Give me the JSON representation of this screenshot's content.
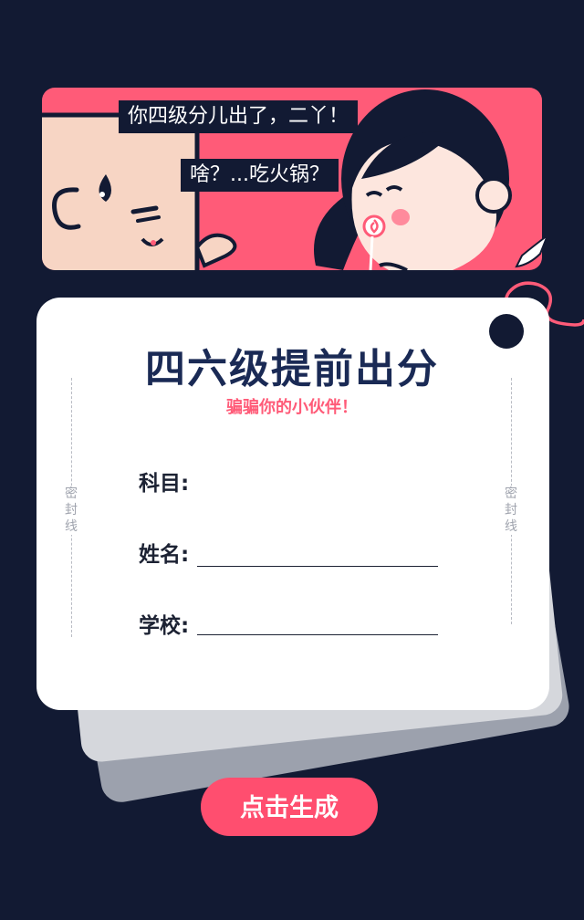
{
  "comic": {
    "bubble_boy": "你四级分儿出了，二丫！",
    "bubble_girl": "啥？...吃火锅？"
  },
  "card": {
    "title": "四六级提前出分",
    "subtitle": "骗骗你的小伙伴！",
    "seal_text_left": "密\n封\n线",
    "seal_text_right": "密\n封\n线"
  },
  "form": {
    "subject_label": "科目:",
    "name_label": "姓名:",
    "school_label": "学校:",
    "name_value": "",
    "school_value": ""
  },
  "action": {
    "generate_label": "点击生成"
  },
  "colors": {
    "background": "#121a33",
    "accent": "#ff5b78",
    "title": "#1a2a55"
  }
}
